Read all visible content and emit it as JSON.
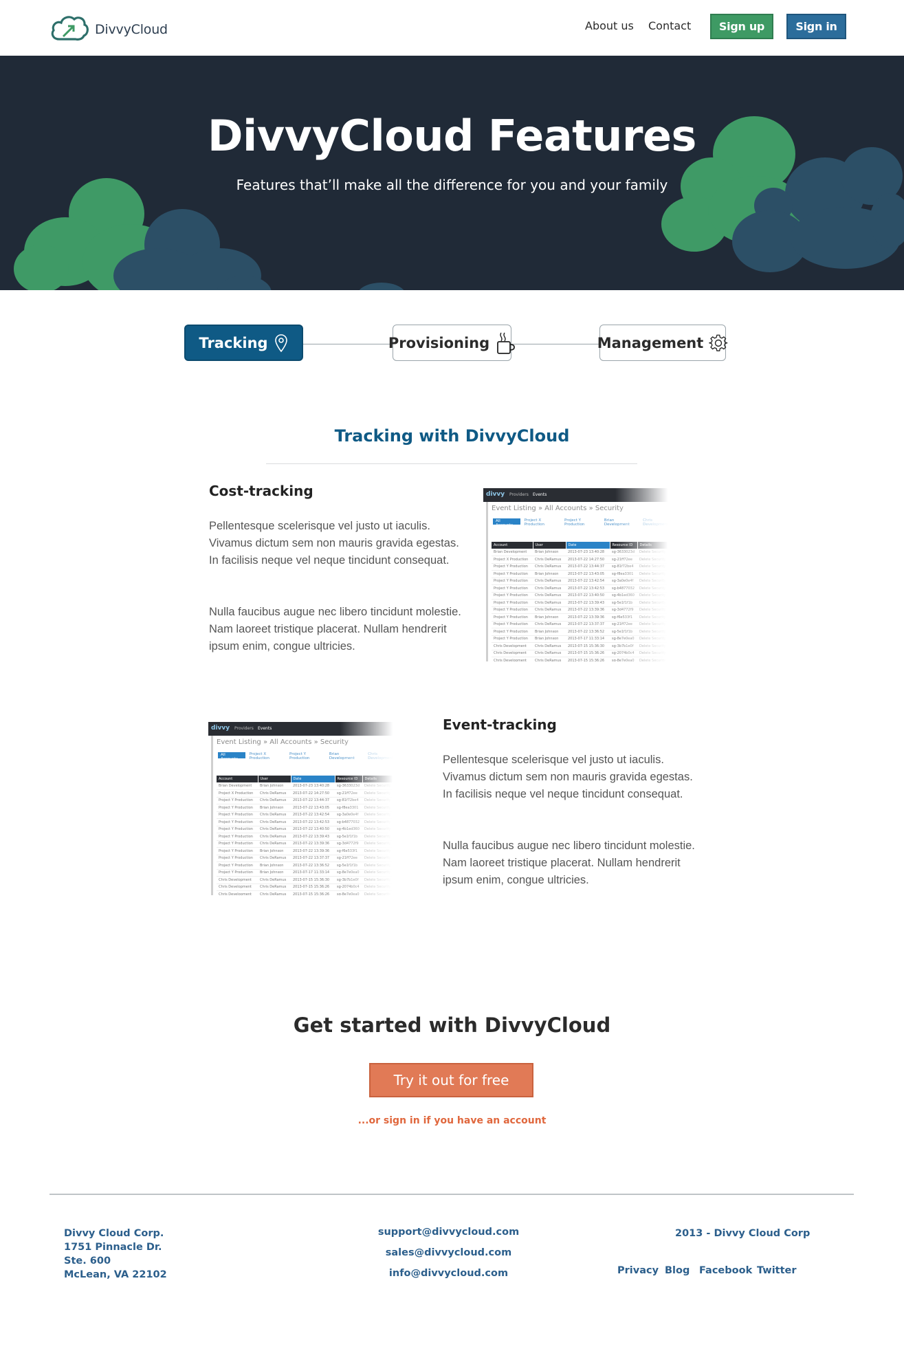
{
  "header": {
    "logo_text": "DivvyCloud",
    "nav": {
      "about": "About us",
      "contact": "Contact"
    },
    "signup_label": "Sign up",
    "signin_label": "Sign in"
  },
  "hero": {
    "title": "DivvyCloud Features",
    "subtitle": "Features that’ll make all the difference for you and your family"
  },
  "tabs": [
    {
      "label": "Tracking",
      "icon": "map-pin-icon",
      "active": true
    },
    {
      "label": "Provisioning",
      "icon": "coffee-mug-icon",
      "active": false
    },
    {
      "label": "Management",
      "icon": "gear-icon",
      "active": false
    }
  ],
  "section": {
    "title": "Tracking with DivvyCloud"
  },
  "features": [
    {
      "title": "Cost-tracking",
      "p1": "Pellentesque scelerisque vel justo ut iaculis. Vivamus dictum sem non mauris gravida egestas. In facilisis neque vel neque tincidunt consequat.",
      "p2": "Nulla faucibus augue nec libero tincidunt molestie. Nam laoreet tristique placerat. Nullam hendrerit ipsum enim, congue ultricies."
    },
    {
      "title": "Event-tracking",
      "p1": "Pellentesque scelerisque vel justo ut iaculis. Vivamus dictum sem non mauris gravida egestas. In facilisis neque vel neque tincidunt consequat.",
      "p2": "Nulla faucibus augue nec libero tincidunt molestie. Nam laoreet tristique placerat. Nullam hendrerit ipsum enim, congue ultricies."
    }
  ],
  "mock": {
    "logo": "divvy",
    "nav": [
      "Providers",
      "Events"
    ],
    "breadcrumb": "Event Listing » All Accounts » Security",
    "filters": [
      "All Accounts",
      "Project X Production",
      "Project Y Production",
      "Brian Development",
      "Chris Development"
    ],
    "columns": [
      "Account",
      "User",
      "Date",
      "Resource ID",
      "Details"
    ],
    "rows": [
      [
        "Brian Development",
        "Brian Johnson",
        "2013-07-23 13:40:28",
        "sg-3633023d",
        "Delete Security"
      ],
      [
        "Project X Production",
        "Chris DeRamus",
        "2013-07-22 14:27:50",
        "sg-21ff72ee",
        "Delete Security"
      ],
      [
        "Project Y Production",
        "Chris DeRamus",
        "2013-07-22 13:44:37",
        "sg-81f72be4",
        "Delete Security"
      ],
      [
        "Project Y Production",
        "Brian Johnson",
        "2013-07-22 13:43:05",
        "sg-f8ea3301",
        "Delete Security"
      ],
      [
        "Project Y Production",
        "Chris DeRamus",
        "2013-07-22 13:42:54",
        "sg-3a0e0e4f",
        "Delete Security"
      ],
      [
        "Project Y Production",
        "Chris DeRamus",
        "2013-07-22 13:42:53",
        "sg-b4877032",
        "Delete Security"
      ],
      [
        "Project Y Production",
        "Chris DeRamus",
        "2013-07-22 13:40:50",
        "sg-4b1ed360",
        "Delete Security"
      ],
      [
        "Project Y Production",
        "Chris DeRamus",
        "2013-07-22 13:39:43",
        "sg-5e1f1f1b",
        "Delete Security"
      ],
      [
        "Project Y Production",
        "Chris DeRamus",
        "2013-07-22 13:39:36",
        "sg-3d4772f9",
        "Delete Security"
      ],
      [
        "Project Y Production",
        "Brian Johnson",
        "2013-07-22 13:39:36",
        "sg-f6e533f1",
        "Delete Security"
      ],
      [
        "Project Y Production",
        "Chris DeRamus",
        "2013-07-22 13:37:37",
        "sg-21ff72ee",
        "Delete Security"
      ],
      [
        "Project Y Production",
        "Brian Johnson",
        "2013-07-22 13:36:52",
        "sg-5e1f1f1b",
        "Delete Security"
      ],
      [
        "Project Y Production",
        "Brian Johnson",
        "2013-07-17 11:33:14",
        "sg-8e7e0ea0",
        "Delete Security"
      ],
      [
        "Chris Development",
        "Chris DeRamus",
        "2013-07-15 15:36:30",
        "sg-3b7b1e0f",
        "Delete Security"
      ],
      [
        "Chris Development",
        "Chris DeRamus",
        "2013-07-15 15:36:26",
        "sg-2074b0c4",
        "Delete Security"
      ],
      [
        "Chris Development",
        "Chris DeRamus",
        "2013-07-15 15:36:26",
        "sg-8e7e0ea0",
        "Delete Security"
      ]
    ]
  },
  "cta": {
    "title": "Get started with DivvyCloud",
    "button": "Try it out for free",
    "link": "...or sign in if you have an account"
  },
  "footer": {
    "address": [
      "Divvy Cloud Corp.",
      "1751 Pinnacle Dr.",
      "Ste. 600",
      "McLean, VA 22102"
    ],
    "emails": [
      "support@divvycloud.com",
      "sales@divvycloud.com",
      "info@divvycloud.com"
    ],
    "copyright": "2013 - Divvy Cloud Corp",
    "links": [
      "Privacy",
      "Blog",
      "Facebook",
      "Twitter"
    ]
  },
  "colors": {
    "hero_bg": "#202a37",
    "accent_blue": "#0f5a85",
    "signup_green": "#3e9a64",
    "signin_blue": "#2c6d9b",
    "cta_orange": "#e17a56",
    "cloud_green": "#3f9a66",
    "cloud_blue": "#2c4f66"
  }
}
